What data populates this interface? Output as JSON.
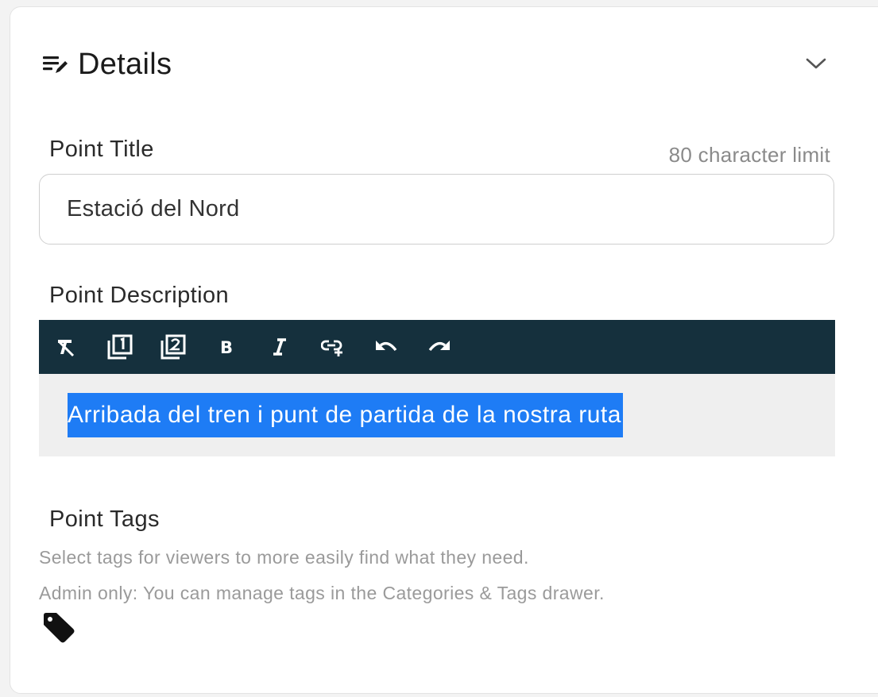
{
  "details": {
    "title": "Details",
    "icon": "edit-note-icon",
    "collapse_icon": "chevron-down-icon"
  },
  "point_title": {
    "label": "Point Title",
    "hint": "80 character limit",
    "value": "Estació del Nord"
  },
  "point_description": {
    "label": "Point Description",
    "toolbar": [
      {
        "name": "clear-format-icon"
      },
      {
        "name": "ordered-list-1-icon"
      },
      {
        "name": "ordered-list-2-icon"
      },
      {
        "name": "bold-icon"
      },
      {
        "name": "italic-icon"
      },
      {
        "name": "link-icon"
      },
      {
        "name": "undo-icon"
      },
      {
        "name": "redo-icon"
      }
    ],
    "text": "Arribada del tren i punt de partida de la nostra ruta",
    "selection_color": "#1e7cf5",
    "toolbar_color": "#15303d"
  },
  "point_tags": {
    "label": "Point Tags",
    "help_line1": "Select tags for viewers to more easily find what they need.",
    "help_line2": "Admin only: You can manage tags in the Categories & Tags drawer.",
    "icon": "tag-icon"
  }
}
